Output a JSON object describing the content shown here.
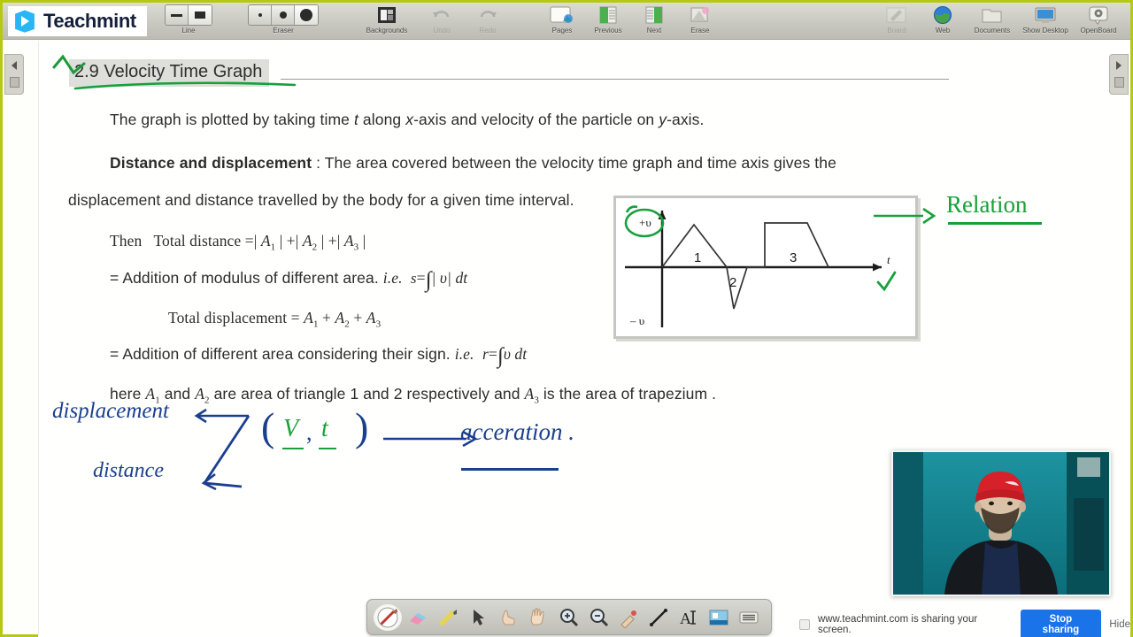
{
  "app": {
    "brand": "Teachmint",
    "logo_icon": "teachmint-book-play-logo"
  },
  "toolbar": {
    "items": [
      {
        "label": "Line",
        "icon": "line-thickness-icon",
        "disabled": false
      },
      {
        "label": "Eraser",
        "icon": "eraser-size-icon",
        "disabled": false
      },
      {
        "label": "Backgrounds",
        "icon": "backgrounds-icon",
        "disabled": false
      },
      {
        "label": "Undo",
        "icon": "undo-icon",
        "disabled": true
      },
      {
        "label": "Redo",
        "icon": "redo-icon",
        "disabled": true
      },
      {
        "label": "Pages",
        "icon": "pages-icon",
        "disabled": false
      },
      {
        "label": "Previous",
        "icon": "previous-page-icon",
        "disabled": false
      },
      {
        "label": "Next",
        "icon": "next-page-icon",
        "disabled": false
      },
      {
        "label": "Erase",
        "icon": "erase-all-icon",
        "disabled": false
      }
    ],
    "right_items": [
      {
        "label": "Board",
        "icon": "board-icon",
        "disabled": true
      },
      {
        "label": "Web",
        "icon": "web-globe-icon",
        "disabled": false
      },
      {
        "label": "Documents",
        "icon": "documents-icon",
        "disabled": false
      },
      {
        "label": "Show Desktop",
        "icon": "show-desktop-icon",
        "disabled": false
      },
      {
        "label": "OpenBoard",
        "icon": "openboard-icon",
        "disabled": false
      }
    ]
  },
  "side_panels": {
    "left": {
      "name": "left-panel-handle",
      "icon": "chevron-left-icon"
    },
    "right": {
      "name": "right-panel-handle",
      "icon": "chevron-right-icon"
    }
  },
  "slide": {
    "title": "2.9 Velocity Time Graph",
    "lines": {
      "l1": "The graph is plotted by taking time t along x-axis and velocity of the particle on y-axis.",
      "l2_bold": "Distance and displacement",
      "l2_rest": ": The area covered between the velocity time graph and time axis gives the",
      "l3": "displacement and distance travelled by the body for a given time interval.",
      "l4_pre": "Then   Total distance =|",
      "l5": "= Addition of modulus of different area.",
      "l5_ie": "i.e.",
      "l6_pre": "Total displacement =",
      "l7": "= Addition of different area considering their sign.",
      "l7_ie": "i.e.",
      "l8": "here A₁ and A₂ are area of triangle 1 and 2 respectively and A₃ is the area of trapezium ."
    },
    "formulas": {
      "total_distance": "|A₁| + |A₂| + |A₃|",
      "s_integral": "s = ∫ |v| dt",
      "total_displacement": "A₁ + A₂ + A₃",
      "r_integral": "r = ∫ v dt"
    }
  },
  "figure": {
    "name": "velocity-time-graph",
    "axis_pos_label": "+v",
    "axis_neg_label": "– v",
    "time_axis_label": "t",
    "region_labels": [
      "1",
      "2",
      "3"
    ]
  },
  "annotations": {
    "colors": {
      "green": "#1a9a3c",
      "blue": "#1b3f8f"
    },
    "green": [
      {
        "name": "title-underline-annotation",
        "text": ""
      },
      {
        "name": "plus-v-circle-annotation",
        "text": ""
      },
      {
        "name": "relation-annotation",
        "text": "Relation"
      },
      {
        "name": "t-axis-tick-annotation",
        "text": ""
      }
    ],
    "blue": [
      {
        "name": "displacement-annotation",
        "text": "displacement"
      },
      {
        "name": "distance-annotation",
        "text": "distance"
      },
      {
        "name": "acceleration-annotation",
        "text": "acceration ."
      }
    ],
    "bracket": {
      "open": "(",
      "v": "V",
      "comma": ",",
      "t": "t",
      "close": ")"
    }
  },
  "dock": {
    "tools": [
      {
        "label": "Pen",
        "icon": "pen-icon",
        "active": true
      },
      {
        "label": "Eraser",
        "icon": "eraser-icon",
        "active": false
      },
      {
        "label": "Highlighter",
        "icon": "highlighter-icon",
        "active": false
      },
      {
        "label": "Select",
        "icon": "cursor-arrow-icon",
        "active": false
      },
      {
        "label": "Pointer",
        "icon": "hand-point-icon",
        "active": false
      },
      {
        "label": "Pan",
        "icon": "hand-open-icon",
        "active": false
      },
      {
        "label": "Zoom In",
        "icon": "zoom-in-icon",
        "active": false
      },
      {
        "label": "Zoom Out",
        "icon": "zoom-out-icon",
        "active": false
      },
      {
        "label": "Laser",
        "icon": "laser-pointer-icon",
        "active": false
      },
      {
        "label": "Line",
        "icon": "line-tool-icon",
        "active": false
      },
      {
        "label": "Text",
        "icon": "text-tool-icon",
        "active": false
      },
      {
        "label": "Capture",
        "icon": "capture-icon",
        "active": false
      },
      {
        "label": "Menu",
        "icon": "menu-lines-icon",
        "active": false
      }
    ]
  },
  "share_bar": {
    "message": "www.teachmint.com is sharing your screen.",
    "stop_label": "Stop sharing",
    "hide_label": "Hide",
    "accent": "#1a73e8",
    "border_color": "#b5c914"
  },
  "webcam": {
    "name": "presenter-webcam-feed"
  }
}
